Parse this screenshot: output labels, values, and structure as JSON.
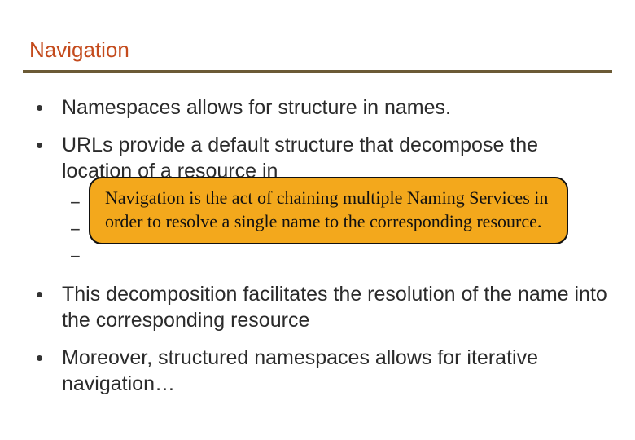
{
  "title": "Navigation",
  "bullets": {
    "b0": "Namespaces allows for structure in names.",
    "b1": "URLs provide a default structure that decompose the location of a resource in",
    "b2": "This decomposition facilitates the resolution of the name into the corresponding resource",
    "b3": "Moreover, structured namespaces allows for iterative navigation…"
  },
  "sub_placeholders": [
    "",
    "",
    ""
  ],
  "callout": "Navigation is the act of chaining multiple Naming Services in order to resolve a single name to the corresponding resource."
}
